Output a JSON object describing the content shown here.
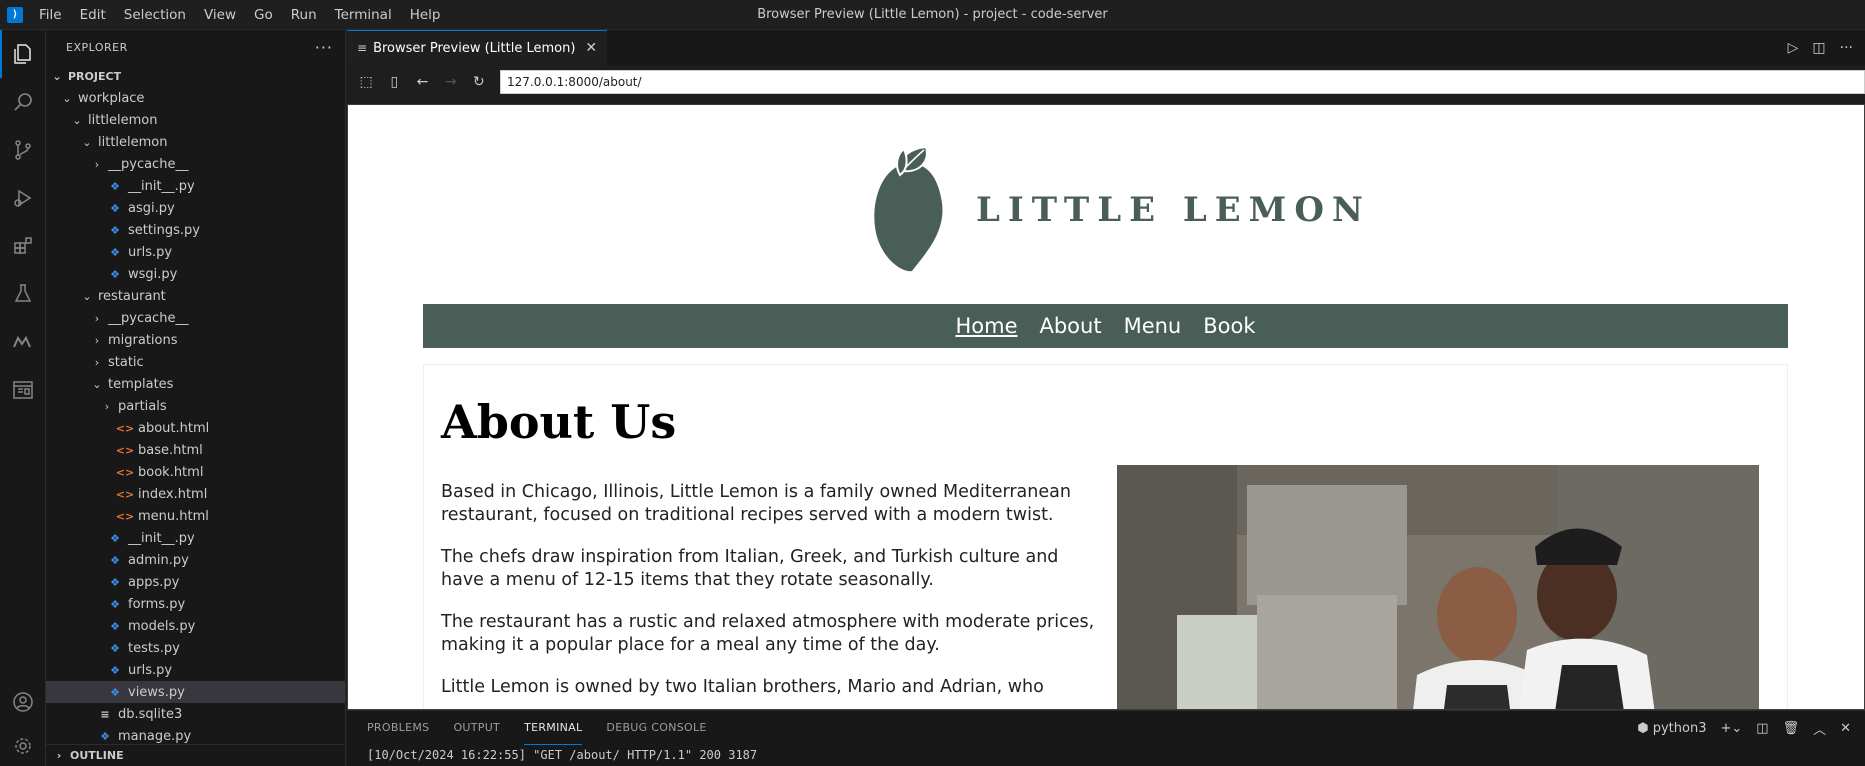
{
  "menubar": {
    "items": [
      "File",
      "Edit",
      "Selection",
      "View",
      "Go",
      "Run",
      "Terminal",
      "Help"
    ],
    "window_title": "Browser Preview (Little Lemon) - project - code-server"
  },
  "activitybar": {
    "icons": [
      "explorer-icon",
      "search-icon",
      "source-control-icon",
      "run-debug-icon",
      "extensions-icon",
      "testing-icon",
      "markdown-icon",
      "browser-preview-icon",
      "account-icon",
      "settings-gear-icon"
    ]
  },
  "sidebar": {
    "title": "EXPLORER",
    "more": "···",
    "tree": [
      {
        "label": "PROJECT",
        "depth": 0,
        "kind": "root",
        "open": true
      },
      {
        "label": "workplace",
        "depth": 1,
        "kind": "folder",
        "open": true
      },
      {
        "label": "littlelemon",
        "depth": 2,
        "kind": "folder",
        "open": true
      },
      {
        "label": "littlelemon",
        "depth": 3,
        "kind": "folder",
        "open": true
      },
      {
        "label": "__pycache__",
        "depth": 4,
        "kind": "folder",
        "open": false
      },
      {
        "label": "__init__.py",
        "depth": 4,
        "kind": "py"
      },
      {
        "label": "asgi.py",
        "depth": 4,
        "kind": "py"
      },
      {
        "label": "settings.py",
        "depth": 4,
        "kind": "py"
      },
      {
        "label": "urls.py",
        "depth": 4,
        "kind": "py"
      },
      {
        "label": "wsgi.py",
        "depth": 4,
        "kind": "py"
      },
      {
        "label": "restaurant",
        "depth": 3,
        "kind": "folder",
        "open": true
      },
      {
        "label": "__pycache__",
        "depth": 4,
        "kind": "folder",
        "open": false
      },
      {
        "label": "migrations",
        "depth": 4,
        "kind": "folder",
        "open": false
      },
      {
        "label": "static",
        "depth": 4,
        "kind": "folder",
        "open": false
      },
      {
        "label": "templates",
        "depth": 4,
        "kind": "folder",
        "open": true
      },
      {
        "label": "partials",
        "depth": 5,
        "kind": "folder",
        "open": false
      },
      {
        "label": "about.html",
        "depth": 5,
        "kind": "html"
      },
      {
        "label": "base.html",
        "depth": 5,
        "kind": "html"
      },
      {
        "label": "book.html",
        "depth": 5,
        "kind": "html"
      },
      {
        "label": "index.html",
        "depth": 5,
        "kind": "html"
      },
      {
        "label": "menu.html",
        "depth": 5,
        "kind": "html"
      },
      {
        "label": "__init__.py",
        "depth": 4,
        "kind": "py"
      },
      {
        "label": "admin.py",
        "depth": 4,
        "kind": "py"
      },
      {
        "label": "apps.py",
        "depth": 4,
        "kind": "py"
      },
      {
        "label": "forms.py",
        "depth": 4,
        "kind": "py"
      },
      {
        "label": "models.py",
        "depth": 4,
        "kind": "py"
      },
      {
        "label": "tests.py",
        "depth": 4,
        "kind": "py"
      },
      {
        "label": "urls.py",
        "depth": 4,
        "kind": "py"
      },
      {
        "label": "views.py",
        "depth": 4,
        "kind": "py",
        "selected": true
      },
      {
        "label": "db.sqlite3",
        "depth": 3,
        "kind": "db"
      },
      {
        "label": "manage.py",
        "depth": 3,
        "kind": "py"
      }
    ],
    "outline_label": "OUTLINE"
  },
  "editor": {
    "tab_label": "Browser Preview (Little Lemon)",
    "url": "127.0.0.1:8000/about/"
  },
  "site": {
    "brand": "LITTLE LEMON",
    "brand_color": "#495e57",
    "nav": [
      "Home",
      "About",
      "Menu",
      "Book"
    ],
    "heading": "About Us",
    "paragraphs": [
      "Based in Chicago, Illinois, Little Lemon is a family owned Mediterranean restaurant, focused on traditional recipes served with a modern twist.",
      "The chefs draw inspiration from Italian, Greek, and Turkish culture and have a menu of 12-15 items that they rotate seasonally.",
      "The restaurant has a rustic and relaxed atmosphere with moderate prices, making it a popular place for a meal any time of the day.",
      "Little Lemon is owned by two Italian brothers, Mario and Adrian, who"
    ]
  },
  "panel": {
    "tabs": [
      "PROBLEMS",
      "OUTPUT",
      "TERMINAL",
      "DEBUG CONSOLE"
    ],
    "active_tab": "TERMINAL",
    "shell": "python3",
    "terminal_line": "[10/Oct/2024 16:22:55] \"GET /about/ HTTP/1.1\" 200 3187"
  }
}
